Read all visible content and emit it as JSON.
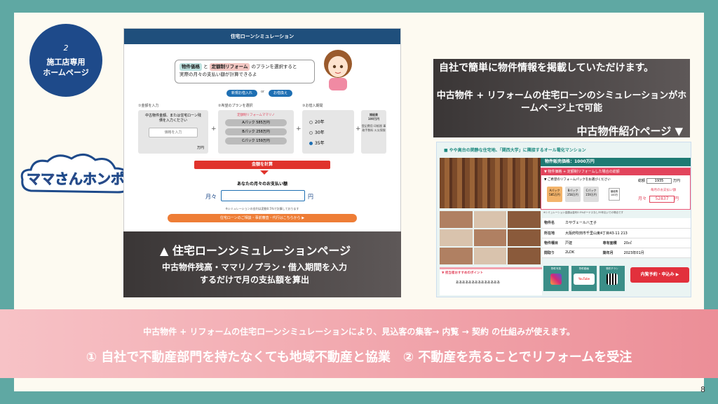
{
  "badge": {
    "number": "2",
    "line1": "施工店専用",
    "line2": "ホームページ"
  },
  "logo_text": "ママさんホンポ",
  "sim": {
    "bar_title": "住宅ローンシミュレーション",
    "bubble_tag1": "物件価格",
    "bubble_and": "と",
    "bubble_tag2": "定額制リフォーム",
    "bubble_rest": "のプランを選択すると",
    "bubble_line2": "実際の月々の支払い額が計算できるよ",
    "btn_new": "新規お借入れ",
    "btn_or": "or",
    "btn_refi": "お借換え",
    "step1": "①金額を入力",
    "step2": "②希望のプランを選択",
    "step3": "③お借入期間",
    "input_label": "中古物件金額、または住宅ローン残債を入力ください",
    "input_placeholder": "価格を入力",
    "yen": "万円",
    "plan_title": "定額制リフォームママリノ",
    "plans": [
      "Aパック 585万円",
      "Bパック 258万円",
      "Cパック 159万円"
    ],
    "terms": [
      "20年",
      "30年",
      "35年"
    ],
    "fee_label": "諸経費",
    "fee_value": "100万円",
    "fee_note": "登記費用 印紙税 事務手数料 火災保険",
    "calc_btn": "金額を計算",
    "monthly_title": "あなたの月々のお支払い額",
    "monthly_label": "月々",
    "monthly_unit": "円",
    "note": "※シミュレーションの金利は変動0.5%で計算しております",
    "cta": "住宅ローンのご相談・事前審査・代行はこちらから ▶"
  },
  "left_caption": {
    "heading": "▲ 住宅ローンシミュレーションページ",
    "desc": "中古物件残高・ママリノプラン・借入期間を入力するだけで月の支払額を算出"
  },
  "right_caption": {
    "line1": "自社で簡単に物件情報を掲載していただけます。",
    "line2": "中古物件 + リフォームの住宅ローンのシミュレーションがホームページ上で可能",
    "label": "中古物件紹介ページ ▼"
  },
  "listing": {
    "header": "■ やや高台の閑静な住宅地、「関西大学」に隣接するオール電化マンション",
    "price": "物件販売価格：1000万円",
    "sim_title": "▼ 物件価格 + 定額制リフォームした場合の総額",
    "sim_sub": "▼ ご希望のリフォームパックをお選びください",
    "packs": [
      {
        "name": "Aパック",
        "price": "585万円"
      },
      {
        "name": "Bパック",
        "price": "258万円"
      },
      {
        "name": "Cパック",
        "price": "159万円"
      }
    ],
    "fee": "諸経費 100万",
    "total_label": "総額",
    "total_value": "1935",
    "total_unit": "万円",
    "monthly_label": "毎月のお支払い額",
    "monthly_prefix": "月々",
    "monthly_value": "52837",
    "monthly_unit": "円",
    "sim_note": "※シミュレーション金額は金利0.5%ボーナスなし35年払いでの場合です",
    "spec": [
      [
        "物件名",
        "カサヴェール八王子"
      ],
      [
        "所在地",
        "大阪府吹田市千里山東4丁目43-11 213"
      ],
      [
        "物件種目",
        "戸建",
        "専有面積",
        "20㎡"
      ],
      [
        "間取り",
        "2LDK",
        "築年月",
        "2023年01月"
      ]
    ],
    "points_title": "▼ 担当者おすすめのポイント",
    "points_text": "ああああああああああああああ",
    "icons": [
      "物件写真",
      "物件動画",
      "物件チラシ"
    ],
    "youtube": "YouTube",
    "reserve": "内覧予約・申込み ▶"
  },
  "band": {
    "line1": "中古物件 + リフォームの住宅ローンシミュレーションにより、見込客の集客→ 内覧 → 契約 の仕組みが使えます。",
    "line2": "① 自社で不動産部門を持たなくても地域不動産と協業　② 不動産を売ることでリフォームを受注"
  },
  "page_number": "8"
}
